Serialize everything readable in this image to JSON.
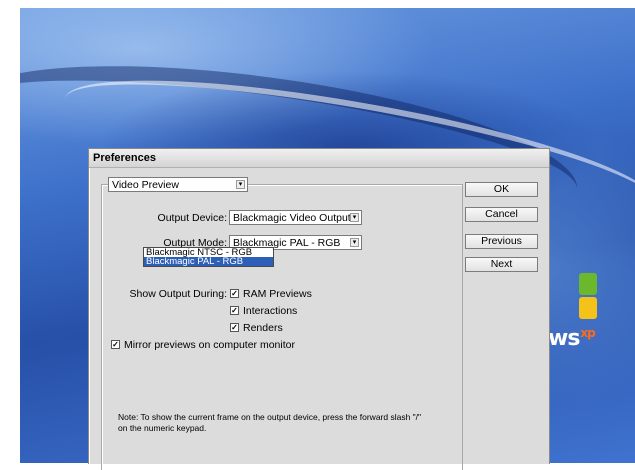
{
  "dialog": {
    "title": "Preferences"
  },
  "panel": {
    "selected": "Video Preview"
  },
  "output_device": {
    "label": "Output Device:",
    "value": "Blackmagic Video Output"
  },
  "output_mode": {
    "label": "Output Mode:",
    "value": "Blackmagic PAL - RGB",
    "options": [
      "Blackmagic NTSC - RGB",
      "Blackmagic PAL - RGB"
    ],
    "highlighted_option": "Blackmagic PAL - RGB"
  },
  "show_output": {
    "label": "Show Output During:",
    "items": [
      {
        "label": "RAM Previews",
        "checked": true
      },
      {
        "label": "Interactions",
        "checked": true
      },
      {
        "label": "Renders",
        "checked": true
      }
    ]
  },
  "mirror": {
    "label": "Mirror previews on computer monitor",
    "checked": true
  },
  "note": "Note:  To show the current frame on the output device, press the forward slash \"/\" on the numeric keypad.",
  "buttons": {
    "ok": "OK",
    "cancel": "Cancel",
    "previous": "Previous",
    "next": "Next"
  },
  "desktop": {
    "os_brand": "ws",
    "os_brand_sup": "xp"
  },
  "colors": {
    "selection": "#2d5fb8",
    "dialog_bg": "#dcdcdc"
  },
  "icons": {
    "dropdown": "chevron-down-icon",
    "check": "checkmark-icon"
  }
}
